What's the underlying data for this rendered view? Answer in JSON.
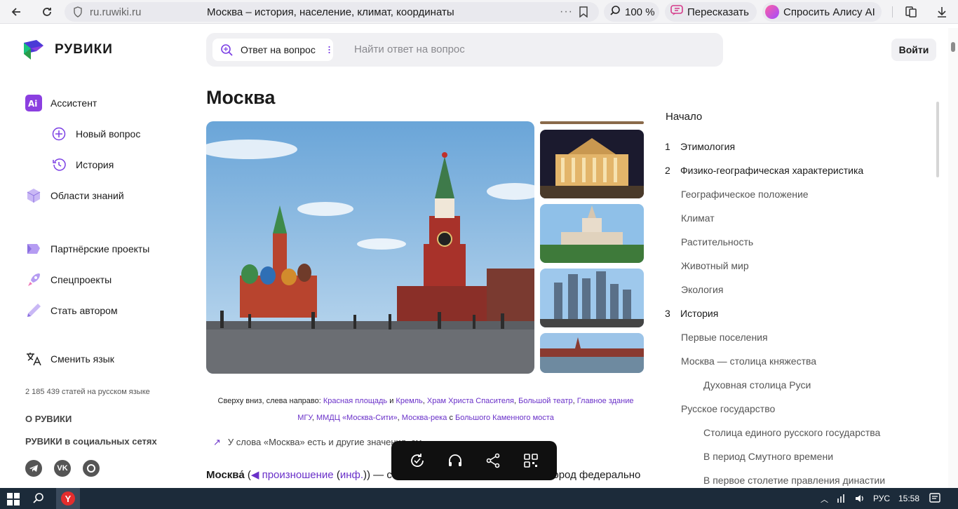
{
  "browser": {
    "domain": "ru.ruwiki.ru",
    "page_title": "Москва – история, население, климат, координаты",
    "zoom": "100 %",
    "retell_label": "Пересказать",
    "ask_alice_label": "Спросить Алису AI"
  },
  "header": {
    "logo_text": "РУВИКИ",
    "search_mode": "Ответ на вопрос",
    "search_placeholder": "Найти ответ на вопрос",
    "login_label": "Войти"
  },
  "sidebar": {
    "assistant": "Ассистент",
    "new_question": "Новый вопрос",
    "history": "История",
    "knowledge_areas": "Области знаний",
    "partner_projects": "Партнёрские проекты",
    "special_projects": "Спецпроекты",
    "become_author": "Стать автором",
    "change_language": "Сменить язык",
    "articles_count": "2 185 439 статей на русском языке",
    "about": "О РУВИКИ",
    "social_title": "РУВИКИ в социальных сетях"
  },
  "article": {
    "title": "Москва",
    "caption_prefix": "Сверху вниз, слева направо:",
    "caption_links": [
      "Красная площадь",
      "Кремль",
      "Храм Христа Спасителя",
      "Большой театр",
      "Главное здание МГУ",
      "ММДЦ «Москва-Сити»",
      "Москва-река"
    ],
    "caption_mid": "с",
    "caption_last_link": "Большого Каменного моста",
    "disambiguation": "У слова «Москва» есть и другие значения, см.",
    "lead_word": "Москва́",
    "lead_pron": "произношение",
    "lead_inf": "инф.",
    "lead_tail": "— столица Российской Федерации, город федерального значения,"
  },
  "toc": {
    "heading": "Начало",
    "items": [
      {
        "num": "1",
        "label": "Этимология",
        "level": 1
      },
      {
        "num": "2",
        "label": "Физико-географическая характеристика",
        "level": 1
      },
      {
        "num": "",
        "label": "Географическое положение",
        "level": 2
      },
      {
        "num": "",
        "label": "Климат",
        "level": 2
      },
      {
        "num": "",
        "label": "Растительность",
        "level": 2
      },
      {
        "num": "",
        "label": "Животный мир",
        "level": 2
      },
      {
        "num": "",
        "label": "Экология",
        "level": 2
      },
      {
        "num": "3",
        "label": "История",
        "level": 1
      },
      {
        "num": "",
        "label": "Первые поселения",
        "level": 2
      },
      {
        "num": "",
        "label": "Москва — столица княжества",
        "level": 2
      },
      {
        "num": "",
        "label": "Духовная столица Руси",
        "level": 3
      },
      {
        "num": "",
        "label": "Русское государство",
        "level": 2
      },
      {
        "num": "",
        "label": "Столица единого русского государства",
        "level": 3
      },
      {
        "num": "",
        "label": "В период Смутного времени",
        "level": 3
      },
      {
        "num": "",
        "label": "В первое столетие правления династии",
        "level": 3
      }
    ]
  },
  "taskbar": {
    "lang": "РУС",
    "time": "15:58"
  },
  "colors": {
    "link": "#6a31c9",
    "accent": "#7b3fe4",
    "taskbar": "#1c2b3a"
  }
}
